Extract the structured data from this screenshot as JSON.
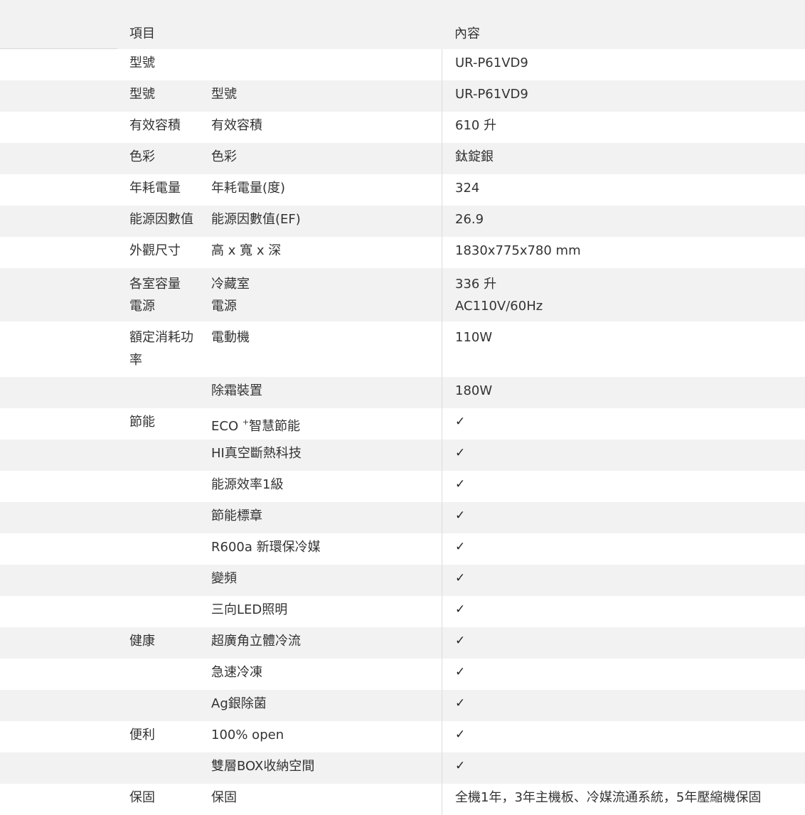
{
  "header": {
    "item": "項目",
    "content": "內容"
  },
  "model_row": {
    "item": "型號",
    "value": "UR-P61VD9"
  },
  "rows": [
    {
      "item": "型號",
      "sub": "型號",
      "value": "UR-P61VD9"
    },
    {
      "item": "有效容積",
      "sub": "有效容積",
      "value": "610 升"
    },
    {
      "item": "色彩",
      "sub": "色彩",
      "value": "鈦錠銀"
    },
    {
      "item": "年耗電量",
      "sub": "年耗電量(度)",
      "value": "324"
    },
    {
      "item": "能源因數值",
      "sub": "能源因數值(EF)",
      "value": "26.9"
    },
    {
      "item": "外觀尺寸",
      "sub": "高 x 寬 x 深",
      "value": "1830x775x780 mm"
    }
  ],
  "capacity_row": {
    "item_1": "各室容量",
    "item_2": "電源",
    "sub_1": "冷藏室",
    "sub_2": "電源",
    "value_1": "336 升",
    "value_2": "AC110V/60Hz"
  },
  "power_row": {
    "item": "額定消耗功率",
    "sub": "電動機",
    "value": "110W"
  },
  "defrost_row": {
    "item": "",
    "sub": "除霜裝置",
    "value": "180W"
  },
  "eco_row": {
    "item": "節能",
    "sub_prefix": "ECO",
    "sub_sup": "+",
    "sub_suffix": "智慧節能",
    "value": "✓"
  },
  "features": [
    {
      "item": "",
      "sub": "HI真空斷熱科技",
      "value": "✓"
    },
    {
      "item": "",
      "sub": "能源效率1級",
      "value": "✓"
    },
    {
      "item": "",
      "sub": "節能標章",
      "value": "✓"
    },
    {
      "item": "",
      "sub": "R600a 新環保冷媒",
      "value": "✓"
    },
    {
      "item": "",
      "sub": "變頻",
      "value": "✓"
    },
    {
      "item": "",
      "sub": "三向LED照明",
      "value": "✓"
    },
    {
      "item": "健康",
      "sub": "超廣角立體冷流",
      "value": "✓"
    },
    {
      "item": "",
      "sub": "急速冷凍",
      "value": "✓"
    },
    {
      "item": "",
      "sub": "Ag銀除菌",
      "value": "✓"
    },
    {
      "item": "便利",
      "sub": "100% open",
      "value": "✓"
    },
    {
      "item": "",
      "sub": "雙層BOX收納空間",
      "value": "✓"
    }
  ],
  "warranty_row": {
    "item": "保固",
    "sub": "保固",
    "value": "全機1年，3年主機板、冷媒流通系統，5年壓縮機保固"
  },
  "colors": {
    "stripe": "#f2f2f2",
    "text": "#333333",
    "divider": "#dcdcdc"
  }
}
